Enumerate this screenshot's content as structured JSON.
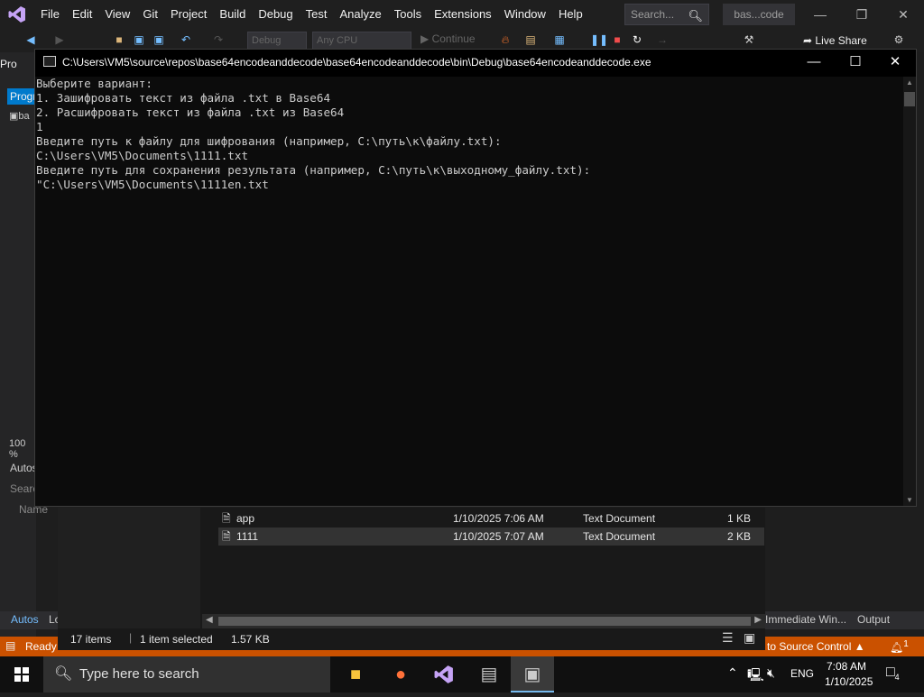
{
  "vs": {
    "menu": [
      "File",
      "Edit",
      "View",
      "Git",
      "Project",
      "Build",
      "Debug",
      "Test",
      "Analyze",
      "Tools",
      "Extensions",
      "Window",
      "Help"
    ],
    "search_placeholder": "Search...",
    "solution_name": "bas...code",
    "toolbar": {
      "config": "Debug",
      "platform": "Any CPU",
      "continue": "Continue",
      "live_share": "Live Share"
    },
    "sidebar": {
      "tab_prog": "Progr",
      "pro": "Pro",
      "cs_item": "ba",
      "zoom": "100 %",
      "autos": "Autos",
      "search": "Searc",
      "name_col": "Name"
    },
    "bottom_tabs": {
      "autos": "Autos",
      "lo": "Lo",
      "immediate": "Immediate Win...",
      "output": "Output"
    },
    "status": {
      "ready": "Ready",
      "source_control": "d to Source Control",
      "notifications": "1"
    }
  },
  "explorer": {
    "rows": [
      {
        "name": "app",
        "date": "1/10/2025 7:06 AM",
        "type": "Text Document",
        "size": "1 KB"
      },
      {
        "name": "1111",
        "date": "1/10/2025 7:07 AM",
        "type": "Text Document",
        "size": "2 KB"
      }
    ],
    "status": {
      "items": "17 items",
      "selected": "1 item selected",
      "size": "1.57 KB"
    }
  },
  "console": {
    "title": "C:\\Users\\VM5\\source\\repos\\base64encodeanddecode\\base64encodeanddecode\\bin\\Debug\\base64encodeanddecode.exe",
    "text": "Выберите вариант:\n1. Зашифровать текст из файла .txt в Base64\n2. Расшифровать текст из файла .txt из Base64\n1\nВведите путь к файлу для шифрования (например, C:\\путь\\к\\файлу.txt):\nC:\\Users\\VM5\\Documents\\1111.txt\nВведите путь для сохранения результата (например, C:\\путь\\к\\выходному_файлу.txt):\n\"C:\\Users\\VM5\\Documents\\1111en.txt"
  },
  "taskbar": {
    "search_placeholder": "Type here to search",
    "language": "ENG",
    "time": "7:08 AM",
    "date": "1/10/2025",
    "notification_count": "4"
  },
  "colors": {
    "status_orange": "#ca5100",
    "vs_purple": "#c5a3f5"
  }
}
